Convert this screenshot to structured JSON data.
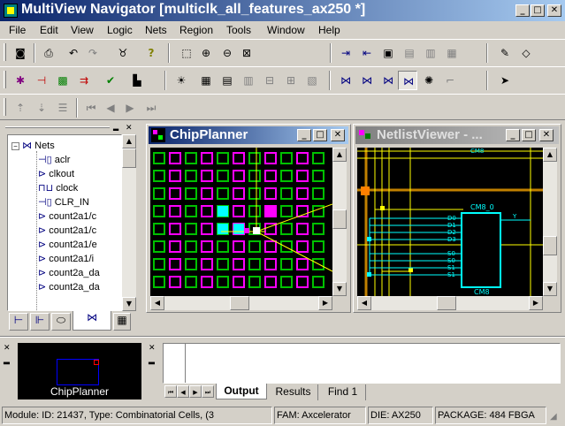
{
  "window": {
    "title": "MultiView Navigator [multiclk_all_features_ax250 *]",
    "min_label": "_",
    "max_label": "□",
    "close_label": "✕"
  },
  "menu": [
    "File",
    "Edit",
    "View",
    "Logic",
    "Nets",
    "Region",
    "Tools",
    "Window",
    "Help"
  ],
  "chipplanner": {
    "title": "ChipPlanner"
  },
  "netlistviewer": {
    "title": "NetlistViewer - ...",
    "top_label": "CM8",
    "block_label": "CM8_0",
    "block_bottom": "CM8",
    "pins_left": [
      "D0",
      "D1",
      "D2",
      "D3",
      "S0",
      "S0",
      "S1",
      "S1"
    ],
    "pin_right": "Y"
  },
  "tree": {
    "root": "Nets",
    "items": [
      "aclr",
      "clkout",
      "clock",
      "CLR_IN",
      "count2a1/c",
      "count2a1/c",
      "count2a1/e",
      "count2a1/i",
      "count2a_da",
      "count2a_da"
    ]
  },
  "bottom_left": {
    "label": "ChipPlanner"
  },
  "output_tabs": [
    "Output",
    "Results",
    "Find 1"
  ],
  "status": {
    "module": "Module: ID: 21437, Type: Combinatorial Cells, (3",
    "fam": "FAM: Axcelerator",
    "die": "DIE: AX250",
    "package": "PACKAGE: 484 FBGA"
  },
  "colors": {
    "title_active": "#0a246a",
    "title_gradient": "#a6caf0",
    "chip_cell_green": "#00c000",
    "chip_cell_magenta": "#ff00ff",
    "chip_cell_cyan": "#00ffff",
    "netlist_bg": "#000000",
    "netlist_wire": "#ffff00",
    "netlist_block": "#00ffff",
    "netlist_bus": "#c08000"
  },
  "icons": {
    "toolbar1": [
      "open-project-icon",
      "print-icon",
      "undo-icon",
      "redo-icon",
      "find-icon",
      "help-icon",
      "zoom-area-icon",
      "zoom-in-icon",
      "zoom-out-icon",
      "zoom-fit-icon",
      "import-icon",
      "export-icon",
      "lock-icon",
      "lock-all-icon",
      "unlock-icon",
      "pencil-icon",
      "eraser-icon"
    ],
    "toolbar2": [
      "chip-icon",
      "netlist-icon",
      "color-icon",
      "flow-icon",
      "check-icon",
      "layout-icon",
      "new-region-icon",
      "grid-icon",
      "grid-small-icon",
      "assign-icon",
      "move-icon",
      "place-icon",
      "net-left-icon",
      "net-right-icon",
      "net-both-icon",
      "net-select-icon",
      "ratsnest-icon",
      "corner-icon",
      "pointer-icon"
    ],
    "toolbar3": [
      "up-icon",
      "down-icon",
      "stack-icon",
      "first-icon",
      "prev-icon",
      "next-icon",
      "last-icon"
    ]
  }
}
